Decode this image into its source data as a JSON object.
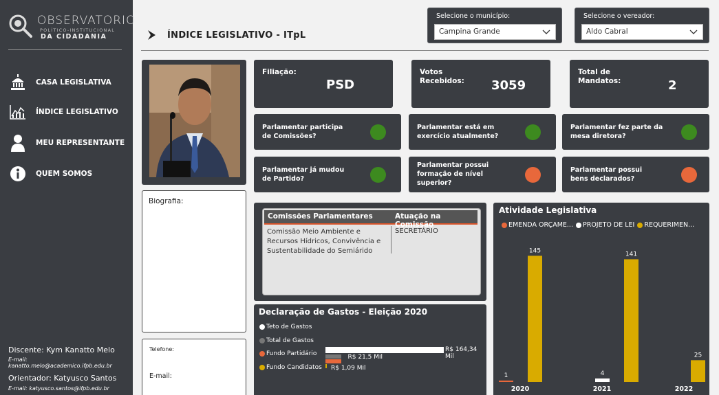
{
  "sidebar": {
    "logo": {
      "title": "OBSERVATORIO",
      "subtitle": "POLÍTICO-INSTITUCIONAL",
      "brand": "DA CIDADANIA"
    },
    "items": [
      {
        "label": "CASA LEGISLATIVA",
        "icon": "capitol-icon"
      },
      {
        "label": "ÍNDICE LEGISLATIVO",
        "icon": "line-chart-icon"
      },
      {
        "label": "MEU REPRESENTANTE",
        "icon": "person-icon"
      },
      {
        "label": "QUEM SOMOS",
        "icon": "info-icon"
      }
    ],
    "credits": {
      "student": "Discente: Kym Kanatto Melo",
      "student_email": "E-mail: kanatto.melo@academico.ifpb.edu.br",
      "advisor": "Orientador: Katyusco Santos",
      "advisor_email": "E-mail: katyusco.santos@ifpb.edu.br"
    }
  },
  "header": {
    "title": "ÍNDICE LEGISLATIVO - ITpL"
  },
  "filters": {
    "municipio": {
      "label": "Selecione o município:",
      "value": "Campina Grande"
    },
    "vereador": {
      "label": "Selecione o vereador:",
      "value": "Aldo Cabral"
    }
  },
  "profile": {
    "bio_label": "Biografia:",
    "phone_label": "Telefone:",
    "email_label": "E-mail:"
  },
  "stats": {
    "filiacao": {
      "label": "Filiação:",
      "value": "PSD"
    },
    "votos": {
      "label1": "Votos",
      "label2": "Recebidos:",
      "value": "3059"
    },
    "mandatos": {
      "label1": "Total de",
      "label2": "Mandatos:",
      "value": "2"
    }
  },
  "questions": [
    {
      "l1": "Parlamentar participa",
      "l2": "de Comissões?",
      "l3": "",
      "status": "yes"
    },
    {
      "l1": "Parlamentar está em",
      "l2": "exercício atualmente?",
      "l3": "",
      "status": "yes"
    },
    {
      "l1": "Parlamentar fez parte da",
      "l2": "mesa diretora?",
      "l3": "",
      "status": "yes"
    },
    {
      "l1": "Parlamentar já mudou",
      "l2": "de Partido?",
      "l3": "",
      "status": "yes"
    },
    {
      "l1": "Parlamentar possui",
      "l2": "formação de nível",
      "l3": "superior?",
      "status": "no"
    },
    {
      "l1": "Parlamentar possui",
      "l2": "bens declarados?",
      "l3": "",
      "status": "no"
    }
  ],
  "colors": {
    "yes": "#3d8a1f",
    "no": "#e8683b",
    "emenda": "#e8683b",
    "projeto": "#ffffff",
    "requerimento": "#d9ab00"
  },
  "commissions": {
    "headers": [
      "Comissões Parlamentares",
      "Atuação na Comissão"
    ],
    "rows": [
      {
        "c1_l1": "Comissão Meio Ambiente e",
        "c1_l2": "Recursos Hídricos, Convivência e",
        "c1_l3": "Sustentabilidade do Semiárido",
        "role": "SECRETÁRIO"
      }
    ]
  },
  "chart_data": [
    {
      "type": "bar",
      "title": "Declaração de Gastos - Eleição 2020",
      "orientation": "horizontal",
      "categories": [
        "Teto de Gastos",
        "Total de Gastos",
        "Fundo Partidário",
        "Fundo Candidatos"
      ],
      "values": [
        164.34,
        21.5,
        21.5,
        1.09
      ],
      "value_labels": [
        "R$ 164,34 Mil",
        "R$ 21,5 Mil",
        "R$ 1,09 Mil"
      ],
      "colors": [
        "#ffffff",
        "#777777",
        "#e8683b",
        "#d9ab00"
      ]
    },
    {
      "type": "bar",
      "title": "Atividade Legislativa",
      "categories": [
        "2020",
        "2021",
        "2022"
      ],
      "series": [
        {
          "name": "EMENDA ORÇAME...",
          "values": [
            1,
            0,
            0
          ]
        },
        {
          "name": "PROJETO DE LEI",
          "values": [
            0,
            4,
            0
          ]
        },
        {
          "name": "REQUERIMEN...",
          "values": [
            145,
            141,
            25
          ]
        }
      ],
      "ylim": [
        0,
        150
      ]
    }
  ]
}
